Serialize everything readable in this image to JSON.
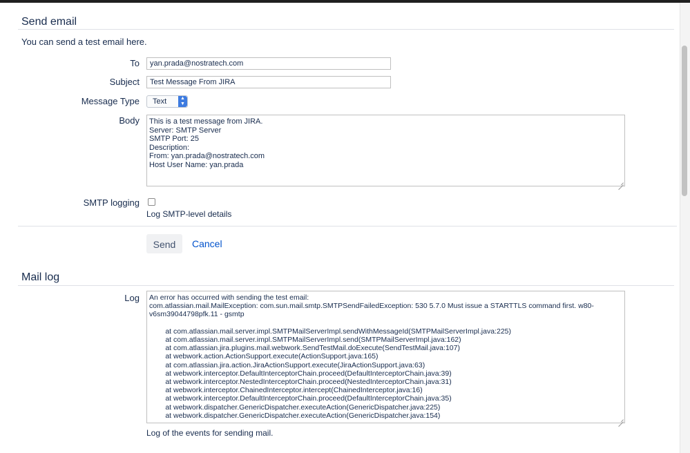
{
  "send_email": {
    "heading": "Send email",
    "description": "You can send a test email here.",
    "to": {
      "label": "To",
      "value": "yan.prada@nostratech.com"
    },
    "subject": {
      "label": "Subject",
      "value": "Test Message From JIRA"
    },
    "message_type": {
      "label": "Message Type",
      "selected": "Text"
    },
    "body": {
      "label": "Body",
      "value": "This is a test message from JIRA.\nServer: SMTP Server\nSMTP Port: 25\nDescription:\nFrom: yan.prada@nostratech.com\nHost User Name: yan.prada"
    },
    "smtp_logging": {
      "label": "SMTP logging",
      "hint": "Log SMTP-level details",
      "checked": false
    },
    "send_label": "Send",
    "cancel_label": "Cancel"
  },
  "mail_log": {
    "heading": "Mail log",
    "log_label": "Log",
    "log_value": "An error has occurred with sending the test email:\ncom.atlassian.mail.MailException: com.sun.mail.smtp.SMTPSendFailedException: 530 5.7.0 Must issue a STARTTLS command first. w80-\nv6sm39044798pfk.11 - gsmtp\n\n        at com.atlassian.mail.server.impl.SMTPMailServerImpl.sendWithMessageId(SMTPMailServerImpl.java:225)\n        at com.atlassian.mail.server.impl.SMTPMailServerImpl.send(SMTPMailServerImpl.java:162)\n        at com.atlassian.jira.plugins.mail.webwork.SendTestMail.doExecute(SendTestMail.java:107)\n        at webwork.action.ActionSupport.execute(ActionSupport.java:165)\n        at com.atlassian.jira.action.JiraActionSupport.execute(JiraActionSupport.java:63)\n        at webwork.interceptor.DefaultInterceptorChain.proceed(DefaultInterceptorChain.java:39)\n        at webwork.interceptor.NestedInterceptorChain.proceed(NestedInterceptorChain.java:31)\n        at webwork.interceptor.ChainedInterceptor.intercept(ChainedInterceptor.java:16)\n        at webwork.interceptor.DefaultInterceptorChain.proceed(DefaultInterceptorChain.java:35)\n        at webwork.dispatcher.GenericDispatcher.executeAction(GenericDispatcher.java:225)\n        at webwork.dispatcher.GenericDispatcher.executeAction(GenericDispatcher.java:154)",
    "log_hint": "Log of the events for sending mail."
  }
}
